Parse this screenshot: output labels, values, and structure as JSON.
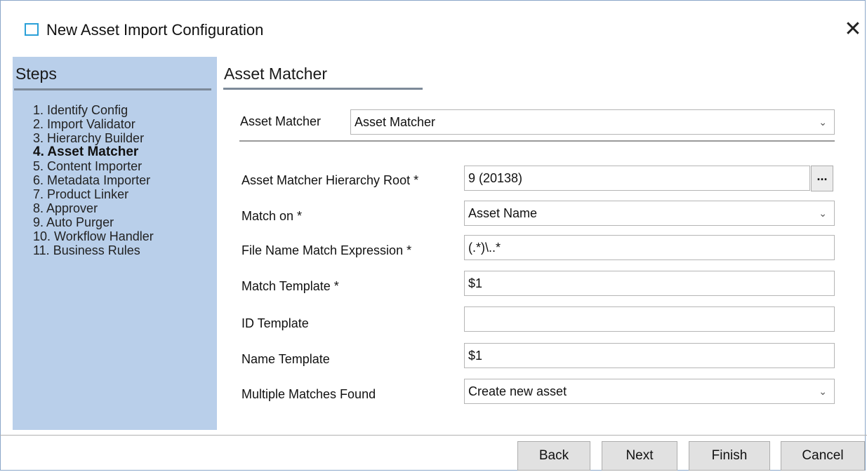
{
  "window": {
    "title": "New Asset Import Configuration",
    "icon": "window-icon",
    "close_icon": "close-icon"
  },
  "sidebar": {
    "title": "Steps",
    "items": [
      {
        "label": "1. Identify Config",
        "active": false
      },
      {
        "label": "2. Import Validator",
        "active": false
      },
      {
        "label": "3. Hierarchy Builder",
        "active": false
      },
      {
        "label": "4. Asset Matcher",
        "active": true
      },
      {
        "label": "5. Content Importer",
        "active": false
      },
      {
        "label": "6. Metadata Importer",
        "active": false
      },
      {
        "label": "7. Product Linker",
        "active": false
      },
      {
        "label": "8. Approver",
        "active": false
      },
      {
        "label": "9. Auto Purger",
        "active": false
      },
      {
        "label": "10. Workflow Handler",
        "active": false
      },
      {
        "label": "11. Business Rules",
        "active": false
      }
    ]
  },
  "main": {
    "title": "Asset Matcher",
    "matcher_select": {
      "label": "Asset Matcher",
      "value": "Asset Matcher"
    },
    "fields": {
      "hierarchy_root": {
        "label": "Asset Matcher Hierarchy Root *",
        "value": "9 (20138)",
        "browse_label": "..."
      },
      "match_on": {
        "label": "Match on *",
        "value": "Asset Name"
      },
      "file_name_expr": {
        "label": "File Name Match Expression *",
        "value": "(.*)\\..*"
      },
      "match_template": {
        "label": "Match Template *",
        "value": "$1"
      },
      "id_template": {
        "label": "ID Template",
        "value": ""
      },
      "name_template": {
        "label": "Name Template",
        "value": "$1"
      },
      "multiple_matches": {
        "label": "Multiple Matches Found",
        "value": "Create new asset"
      }
    }
  },
  "footer": {
    "back": "Back",
    "next": "Next",
    "finish": "Finish",
    "cancel": "Cancel"
  },
  "colors": {
    "sidebar_bg": "#b9cfea",
    "rule": "#7d8a99",
    "icon_accent": "#2aa0d8"
  }
}
